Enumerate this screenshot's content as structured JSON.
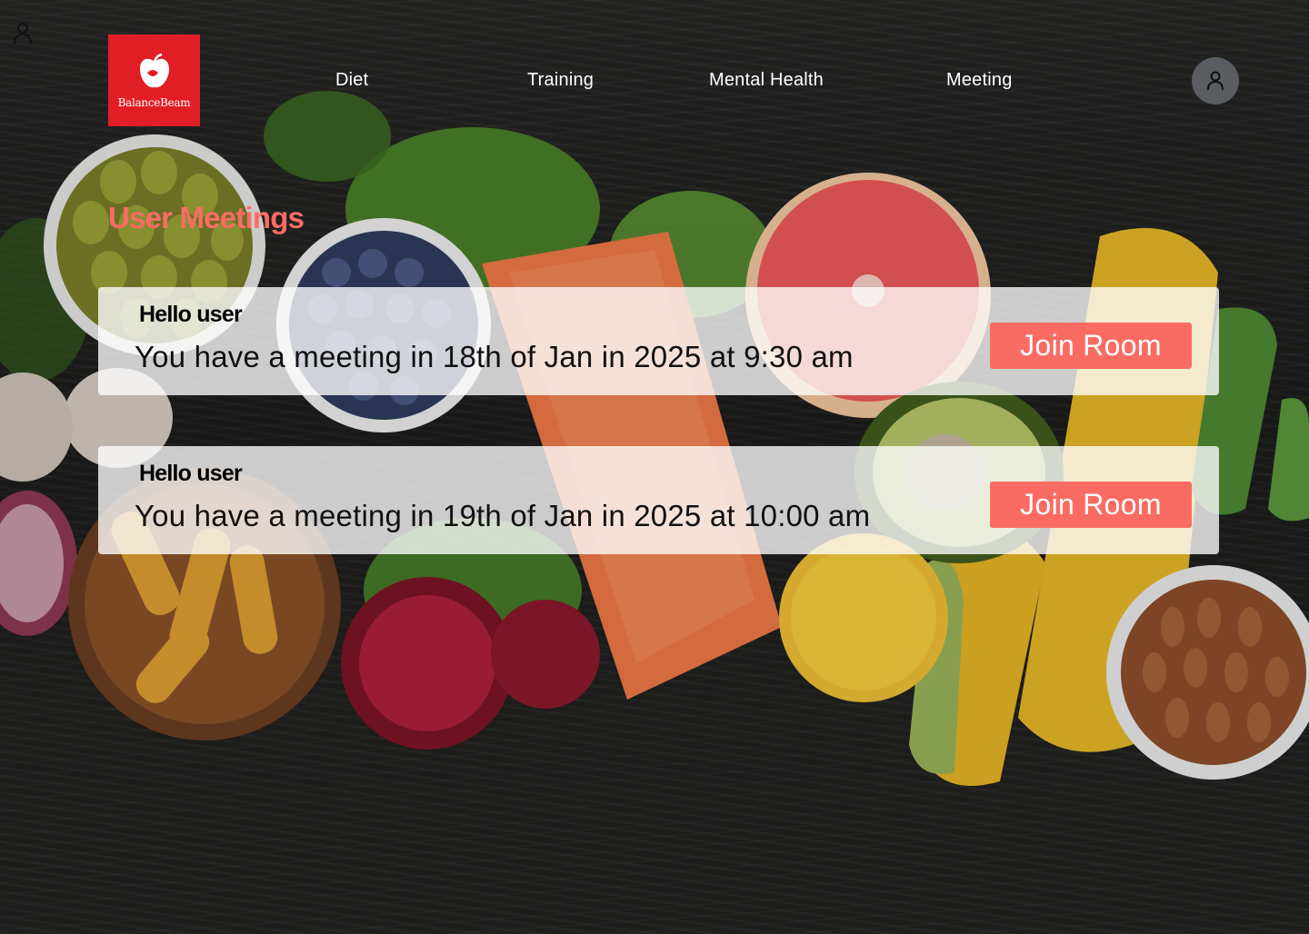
{
  "app": {
    "brand_name": "BalanceBeam",
    "brand_color": "#e11e26",
    "accent_color": "#fa6c63"
  },
  "nav": {
    "items": [
      {
        "label": "Diet"
      },
      {
        "label": "Training"
      },
      {
        "label": "Mental Health"
      },
      {
        "label": "Meeting"
      }
    ],
    "profile_icon": "user-icon"
  },
  "page": {
    "title": "User Meetings"
  },
  "meetings": [
    {
      "greeting": "Hello user",
      "message": "You have a meeting in 18th of Jan in 2025 at 9:30 am",
      "button_label": "Join Room"
    },
    {
      "greeting": "Hello user",
      "message": "You have a meeting in 19th of Jan in 2025 at 10:00 am",
      "button_label": "Join Room"
    }
  ]
}
